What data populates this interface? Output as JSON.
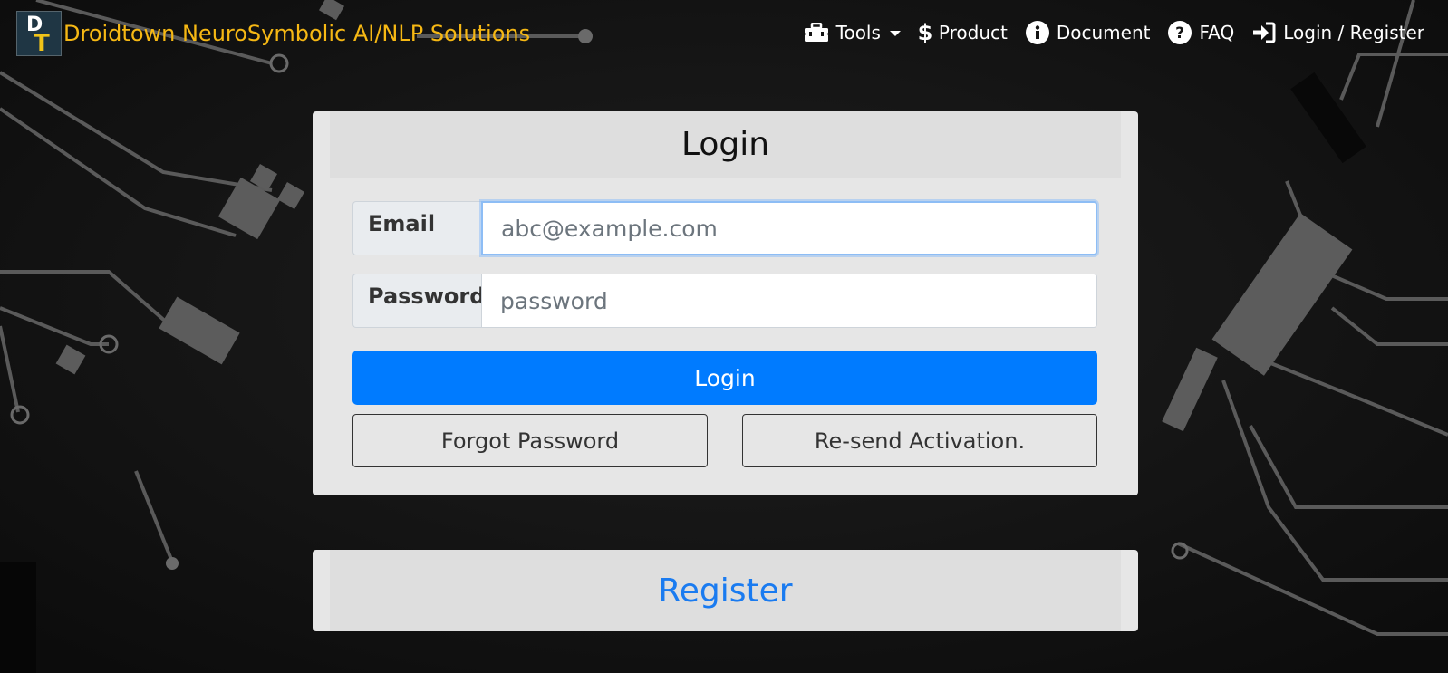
{
  "brand": {
    "name": "Droidtown NeuroSymbolic AI/NLP Solutions",
    "logo_letters": [
      "D",
      "T"
    ],
    "color": "#f6b814"
  },
  "nav": {
    "items": [
      {
        "label": "Tools",
        "icon": "toolbox-icon",
        "dropdown": true
      },
      {
        "label": "Product",
        "icon": "dollar-icon"
      },
      {
        "label": "Document",
        "icon": "info-circle-icon"
      },
      {
        "label": "FAQ",
        "icon": "question-circle-icon"
      },
      {
        "label": "Login / Register",
        "icon": "sign-in-icon"
      }
    ]
  },
  "login": {
    "title": "Login",
    "email_label": "Email",
    "email_placeholder": "abc@example.com",
    "password_label": "Password",
    "password_placeholder": "password",
    "submit_label": "Login",
    "forgot_label": "Forgot Password",
    "resend_label": "Re-send Activation."
  },
  "register": {
    "title": "Register"
  },
  "colors": {
    "primary": "#007bff",
    "link": "#1a7bf0",
    "background": "#141414",
    "card": "#e6e6e6"
  }
}
